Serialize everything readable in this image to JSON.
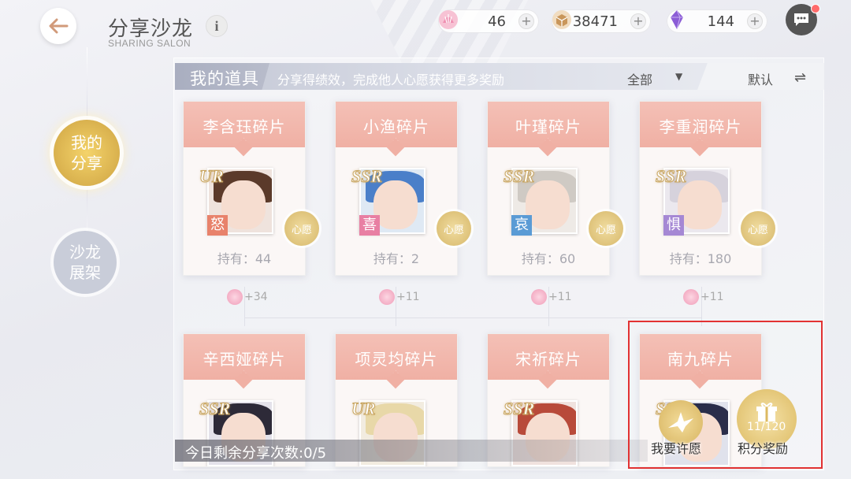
{
  "header": {
    "title": "分享沙龙",
    "subtitle": "SHARING SALON",
    "info_label": "i",
    "currencies": [
      {
        "name": "shell-currency",
        "value": "46",
        "color": "#f08fb0"
      },
      {
        "name": "box-currency",
        "value": "38471",
        "color": "#c9965a"
      },
      {
        "name": "crystal-currency",
        "value": "144",
        "color": "#8b5cd6"
      }
    ],
    "plus": "+"
  },
  "side_tabs": {
    "active": "我的\n分享",
    "inactive": "沙龙\n展架"
  },
  "toolbar": {
    "title": "我的道具",
    "subtitle": "分享得绩效，完成他人心愿获得更多奖励",
    "filter": "全部",
    "filter_arrow": "▼",
    "sort": "默认",
    "sort_icon": "⇌"
  },
  "cards": [
    {
      "name": "李含珏碎片",
      "rarity": "UR",
      "mood": "怒",
      "mood_color": "#e8826b",
      "hair": "#5b3a2a",
      "holding": "持有：44",
      "reward": "+34",
      "wish": "心愿"
    },
    {
      "name": "小渔碎片",
      "rarity": "SSR",
      "mood": "喜",
      "mood_color": "#e87fa3",
      "hair": "#4a7fc9",
      "holding": "持有：2",
      "reward": "+11",
      "wish": "心愿"
    },
    {
      "name": "叶瑾碎片",
      "rarity": "SSR",
      "mood": "哀",
      "mood_color": "#5a9bd5",
      "hair": "#cfcac4",
      "holding": "持有：60",
      "reward": "+11",
      "wish": "心愿"
    },
    {
      "name": "李重润碎片",
      "rarity": "SSR",
      "mood": "惧",
      "mood_color": "#a588d4",
      "hair": "#d6d2dc",
      "holding": "持有：180",
      "reward": "+11",
      "wish": "心愿"
    },
    {
      "name": "辛西娅碎片",
      "rarity": "SSR",
      "hair": "#2d2a38"
    },
    {
      "name": "项灵均碎片",
      "rarity": "UR",
      "hair": "#e8d8a8"
    },
    {
      "name": "宋祈碎片",
      "rarity": "SSR",
      "hair": "#b84a3a"
    },
    {
      "name": "南九碎片",
      "rarity": "SSR",
      "hair": "#2a2d4a"
    }
  ],
  "bottom": {
    "share_count": "今日剩余分享次数:0/5",
    "wish_action": "我要许愿",
    "points_action": "积分奖励",
    "points_progress": "11/120"
  }
}
